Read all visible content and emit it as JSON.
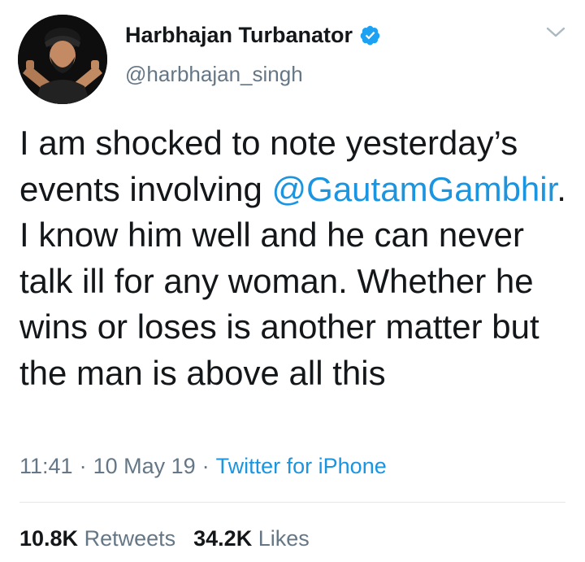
{
  "author": {
    "display_name": "Harbhajan Turbanator",
    "handle": "@harbhajan_singh",
    "verified": true
  },
  "tweet": {
    "text_before_mention": "I am shocked to note yesterday’s events involving ",
    "mention": "@GautamGambhir",
    "text_after_mention": ". I know him well and he can never talk ill for any woman. Whether he wins or loses is another matter but the man is above all this"
  },
  "meta": {
    "time": "11:41",
    "separator": "·",
    "date": "10 May 19",
    "source": "Twitter for iPhone"
  },
  "stats": {
    "retweets_count": "10.8K",
    "retweets_label": "Retweets",
    "likes_count": "34.2K",
    "likes_label": "Likes"
  },
  "colors": {
    "link": "#1b95e0",
    "verified": "#1da1f2",
    "secondary_text": "#657786",
    "divider": "#e1e8ed"
  },
  "icons": {
    "verified": "verified-badge-icon",
    "menu": "chevron-down-icon"
  }
}
